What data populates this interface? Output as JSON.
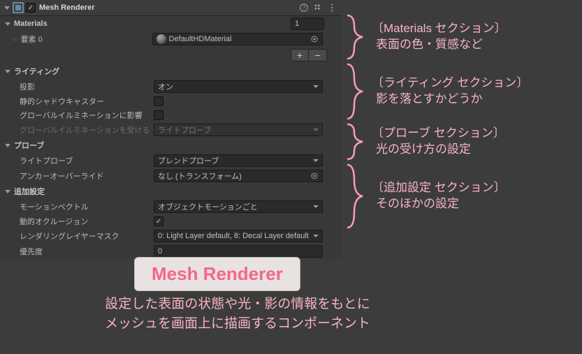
{
  "component": {
    "title": "Mesh Renderer",
    "enabled": true
  },
  "materials": {
    "header": "Materials",
    "count": "1",
    "element0_label": "要素 0",
    "element0_value": "DefaultHDMaterial"
  },
  "lighting": {
    "header": "ライティング",
    "cast_shadows_label": "投影",
    "cast_shadows_value": "オン",
    "static_shadow_caster_label": "静的シャドウキャスター",
    "static_shadow_caster_value": false,
    "contribute_gi_label": "グローバルイルミネーションに影響",
    "contribute_gi_value": false,
    "receive_gi_label": "グローバルイルミネーションを受ける",
    "receive_gi_value": "ライトプローブ"
  },
  "probes": {
    "header": "プローブ",
    "light_probes_label": "ライトプローブ",
    "light_probes_value": "ブレンドプローブ",
    "anchor_label": "アンカーオーバーライド",
    "anchor_value": "なし (トランスフォーム)"
  },
  "additional": {
    "header": "追加設定",
    "motion_vectors_label": "モーションベクトル",
    "motion_vectors_value": "オブジェクトモーションごと",
    "dynamic_occlusion_label": "動的オクルージョン",
    "dynamic_occlusion_value": true,
    "rendering_layer_label": "レンダリングレイヤーマスク",
    "rendering_layer_value": "0: Light Layer default, 8: Decal Layer default",
    "priority_label": "優先度",
    "priority_value": "0"
  },
  "callouts": {
    "materials_t1": "〔Materials セクション〕",
    "materials_t2": "表面の色・質感など",
    "lighting_t1": "〔ライティング セクション〕",
    "lighting_t2": "影を落とすかどうか",
    "probes_t1": "〔プローブ セクション〕",
    "probes_t2": "光の受け方の設定",
    "additional_t1": "〔追加設定 セクション〕",
    "additional_t2": "そのほかの設定"
  },
  "badge": "Mesh Renderer",
  "caption_l1": "設定した表面の状態や光・影の情報をもとに",
  "caption_l2": "メッシュを画面上に描画するコンポーネント"
}
